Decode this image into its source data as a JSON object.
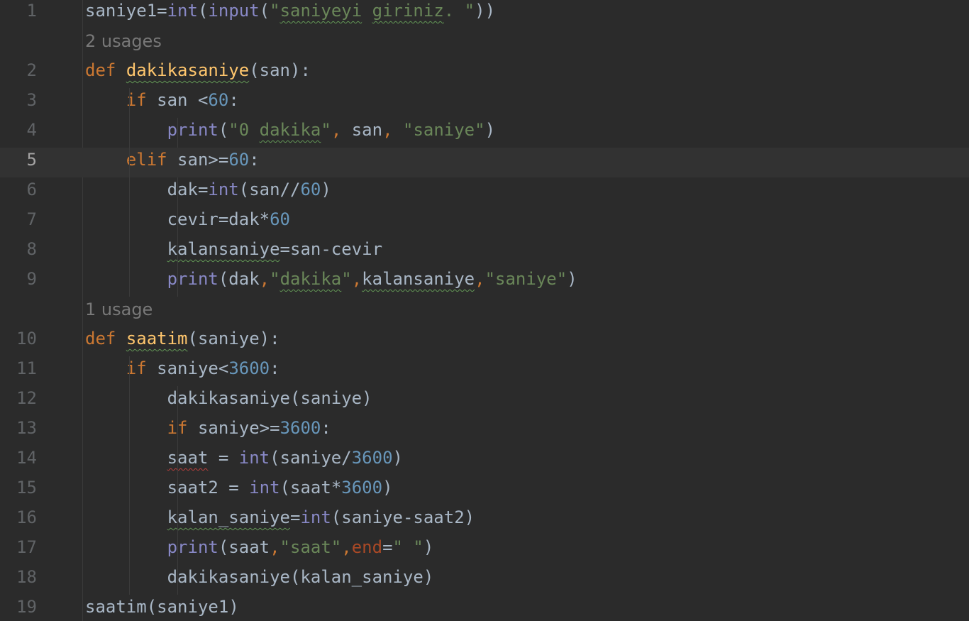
{
  "editor": {
    "language": "python",
    "current_line": 5,
    "colors": {
      "background": "#2b2b2b",
      "current_line": "#323232",
      "keyword": "#cc7832",
      "function_def": "#ffc66d",
      "builtin": "#8888c6",
      "number": "#6897bb",
      "string": "#6a8759",
      "param_name": "#aa4926",
      "default_text": "#a9b7c6",
      "inlay_hint": "#787878"
    },
    "usage_hints": {
      "dakikasaniye": "2 usages",
      "saatim": "1 usage"
    },
    "lines": [
      {
        "num": "1",
        "text": "saniye1=int(input(\"saniyeyi giriniz. \"))"
      },
      {
        "num": "2",
        "text": "def dakikasaniye(san):"
      },
      {
        "num": "3",
        "text": "    if san <60:"
      },
      {
        "num": "4",
        "text": "        print(\"0 dakika\", san, \"saniye\")"
      },
      {
        "num": "5",
        "text": "    elif san>=60:"
      },
      {
        "num": "6",
        "text": "        dak=int(san//60)"
      },
      {
        "num": "7",
        "text": "        cevir=dak*60"
      },
      {
        "num": "8",
        "text": "        kalansaniye=san-cevir"
      },
      {
        "num": "9",
        "text": "        print(dak,\"dakika\",kalansaniye,\"saniye\")"
      },
      {
        "num": "10",
        "text": "def saatim(saniye):"
      },
      {
        "num": "11",
        "text": "    if saniye<3600:"
      },
      {
        "num": "12",
        "text": "        dakikasaniye(saniye)"
      },
      {
        "num": "13",
        "text": "        if saniye>=3600:"
      },
      {
        "num": "14",
        "text": "        saat = int(saniye/3600)"
      },
      {
        "num": "15",
        "text": "        saat2 = int(saat*3600)"
      },
      {
        "num": "16",
        "text": "        kalan_saniye=int(saniye-saat2)"
      },
      {
        "num": "17",
        "text": "        print(saat,\"saat\",end=\" \")"
      },
      {
        "num": "18",
        "text": "        dakikasaniye(kalan_saniye)"
      },
      {
        "num": "19",
        "text": "saatim(saniye1)"
      }
    ]
  }
}
